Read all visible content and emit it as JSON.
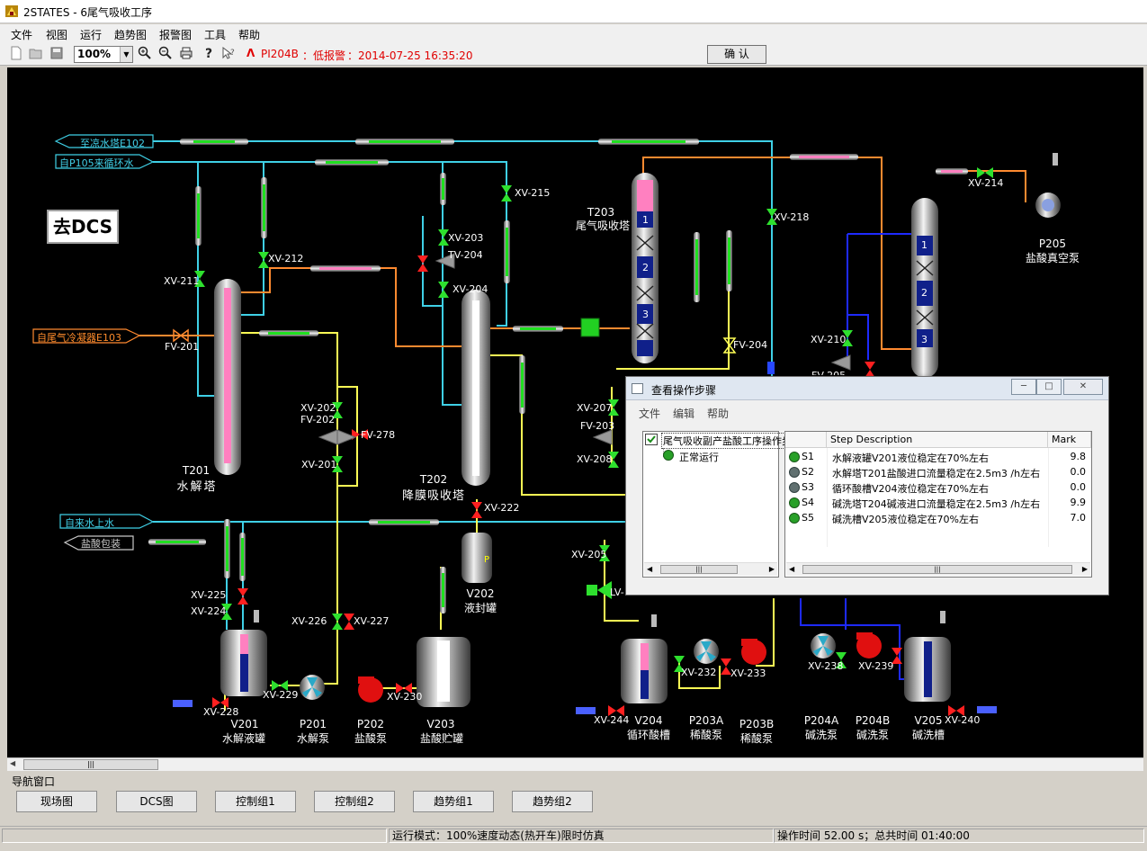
{
  "window": {
    "title": "2STATES - 6尾气吸收工序"
  },
  "menu": [
    "文件",
    "视图",
    "运行",
    "趋势图",
    "报警图",
    "工具",
    "帮助"
  ],
  "toolbar": {
    "zoom": "100%",
    "alarm_tag": "PI204B",
    "alarm_type": "：低报警",
    "alarm_time": "：2014-07-25 16:35:20",
    "confirm_label": "确 认",
    "icons": [
      "new-icon",
      "open-icon",
      "save-icon",
      "zoom-in-icon",
      "zoom-out-icon",
      "print-icon",
      "help-icon",
      "context-help-icon"
    ]
  },
  "process": {
    "go_dcs": "去DCS",
    "streams": {
      "to_cooling_tower": "至凉水塔E102",
      "from_p105": "自P105来循环水",
      "from_cooler": "自尾气冷凝器E103",
      "tap_water": "自来水上水",
      "acid_pack": "盐酸包装"
    },
    "equipment": {
      "T201_id": "T201",
      "T201_name": "水解塔",
      "T202_id": "T202",
      "T202_name": "降膜吸收塔",
      "T203_id": "T203",
      "T203_name": "尾气吸收塔",
      "P205_id": "P205",
      "P205_name": "盐酸真空泵",
      "V202_id": "V202",
      "V202_name": "液封罐",
      "V201_id": "V201",
      "V201_name": "水解液罐",
      "P201_id": "P201",
      "P201_name": "水解泵",
      "P202_id": "P202",
      "P202_name": "盐酸泵",
      "V203_id": "V203",
      "V203_name": "盐酸贮罐",
      "V204_id": "V204",
      "V204_name": "循环酸槽",
      "P203A_id": "P203A",
      "P203A_name": "稀酸泵",
      "P203B_id": "P203B",
      "P203B_name": "稀酸泵",
      "P204A_id": "P204A",
      "P204A_name": "碱洗泵",
      "P204B_id": "P204B",
      "P204B_name": "碱洗泵",
      "V205_id": "V205",
      "V205_name": "碱洗槽"
    },
    "valves": {
      "xv211": "XV-211",
      "fv201": "FV-201",
      "xv212": "XV-212",
      "xv215": "XV-215",
      "xv203": "XV-203",
      "tv204": "TV-204",
      "xv204": "XV-204",
      "xv218": "XV-218",
      "xv214": "XV-214",
      "xv202": "XV-202",
      "fv202": "FV-202",
      "fv278": "FV-278",
      "xv201": "XV-201",
      "xv222": "XV-222",
      "fv204": "FV-204",
      "xv210": "XV-210",
      "fv205": "FV-205",
      "xv207": "XV-207",
      "fv203": "FV-203",
      "xv208": "XV-208",
      "xv205": "XV-205",
      "lv": "LV-",
      "xv225": "XV-225",
      "xv224": "XV-224",
      "xv226": "XV-226",
      "xv227": "XV-227",
      "xv229": "XV-229",
      "xv228": "XV-228",
      "xv230": "XV-230",
      "xv232": "XV-232",
      "xv233": "XV-233",
      "xv238": "XV-238",
      "xv239": "XV-239",
      "xv244": "XV-244",
      "xv240": "XV-240"
    },
    "tray_labels": [
      "1",
      "2",
      "3"
    ],
    "colors": {
      "water": "#3fd0e6",
      "gas": "#ff8a30",
      "acid": "#ffff55",
      "base": "#1e2aff",
      "valve_open": "#2ee02e",
      "valve_closed": "#ff2020"
    }
  },
  "dialog": {
    "title": "查看操作步骤",
    "menu": [
      "文件",
      "编辑",
      "帮助"
    ],
    "tree_root": "尾气吸收副产盐酸工序操作步骤",
    "tree_child": "正常运行",
    "columns": [
      "",
      "Step Description",
      "Mark"
    ],
    "rows": [
      {
        "step": "S1",
        "desc": "水解液罐V201液位稳定在70%左右",
        "mark": "9.8",
        "ok": true
      },
      {
        "step": "S2",
        "desc": "水解塔T201盐酸进口流量稳定在2.5m3 /h左右",
        "mark": "0.0",
        "ok": false
      },
      {
        "step": "S3",
        "desc": "循环酸槽V204液位稳定在70%左右",
        "mark": "0.0",
        "ok": false
      },
      {
        "step": "S4",
        "desc": "碱洗塔T204碱液进口流量稳定在2.5m3 /h左右",
        "mark": "9.9",
        "ok": true
      },
      {
        "step": "S5",
        "desc": "碱洗槽V205液位稳定在70%左右",
        "mark": "7.0",
        "ok": true
      }
    ]
  },
  "nav": {
    "title": "导航窗口",
    "buttons": [
      "现场图",
      "DCS图",
      "控制组1",
      "控制组2",
      "趋势组1",
      "趋势组2"
    ]
  },
  "status": {
    "mode": "运行模式：100%速度动态(热开车)限时仿真",
    "time": "操作时间 52.00 s；总共时间 01:40:00"
  }
}
